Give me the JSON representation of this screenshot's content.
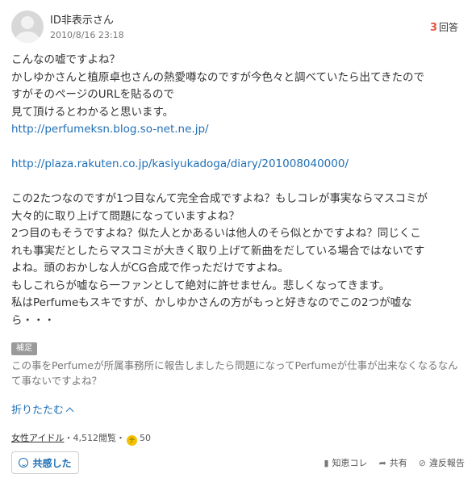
{
  "header": {
    "user_name": "ID非表示さん",
    "post_date": "2010/8/16 23:18",
    "answer_count": "3",
    "answer_label": "回答"
  },
  "question": {
    "lines": [
      "こんなの嘘ですよね？",
      "かしゆかさんと植原卓也さんの熱愛噂なのですが今色々と調べていたら出てきたので",
      "すがそのページのURLを貼るので",
      "見て頂けるとわかると思います。"
    ],
    "link1": "http://perfumeksn.blog.so-net.ne.jp/",
    "link2": "http://plaza.rakuten.co.jp/kasiyukadoga/diary/201008040000/",
    "body_lines": [
      "この2たつなのですが1つ目なんて完全合成ですよね？もしコレが事実ならマスコミが",
      "大々的に取り上げて問題になっていますよね？",
      "2つ目のもそうですよね？似た人とかあるいは他人のそら似とかですよね？同じくこ",
      "れも事実だとしたらマスコミが大きく取り上げて新曲をだしている場合ではないです",
      "よね。頭のおかしな人がCG合成で作っただけですよね。",
      "もしこれらが嘘なら一ファンとして絶対に許せません。悲しくなってきます。",
      "私はPerfumeもスキですが、かしゆかさんの方がもっと好きなのでこの2つが嘘な",
      "ら・・・"
    ]
  },
  "supplement": {
    "badge": "補足",
    "text": "この事をPerfumeが所属事務所に報告しましたら問題になってPerfumeが仕事が出来なくなるなんて事ないですよね？"
  },
  "collapse_label": "折りたたむ",
  "meta": {
    "category": "女性アイドル",
    "views": "・4,512閲覧・",
    "coin_icon": "coin-icon",
    "coins": "50"
  },
  "empathy_label": "共感した",
  "actions": {
    "bookmark": "知恵コレ",
    "share": "共有",
    "report": "違反報告"
  },
  "colors": {
    "link": "#1f6fb5",
    "accent": "#e8543f"
  }
}
